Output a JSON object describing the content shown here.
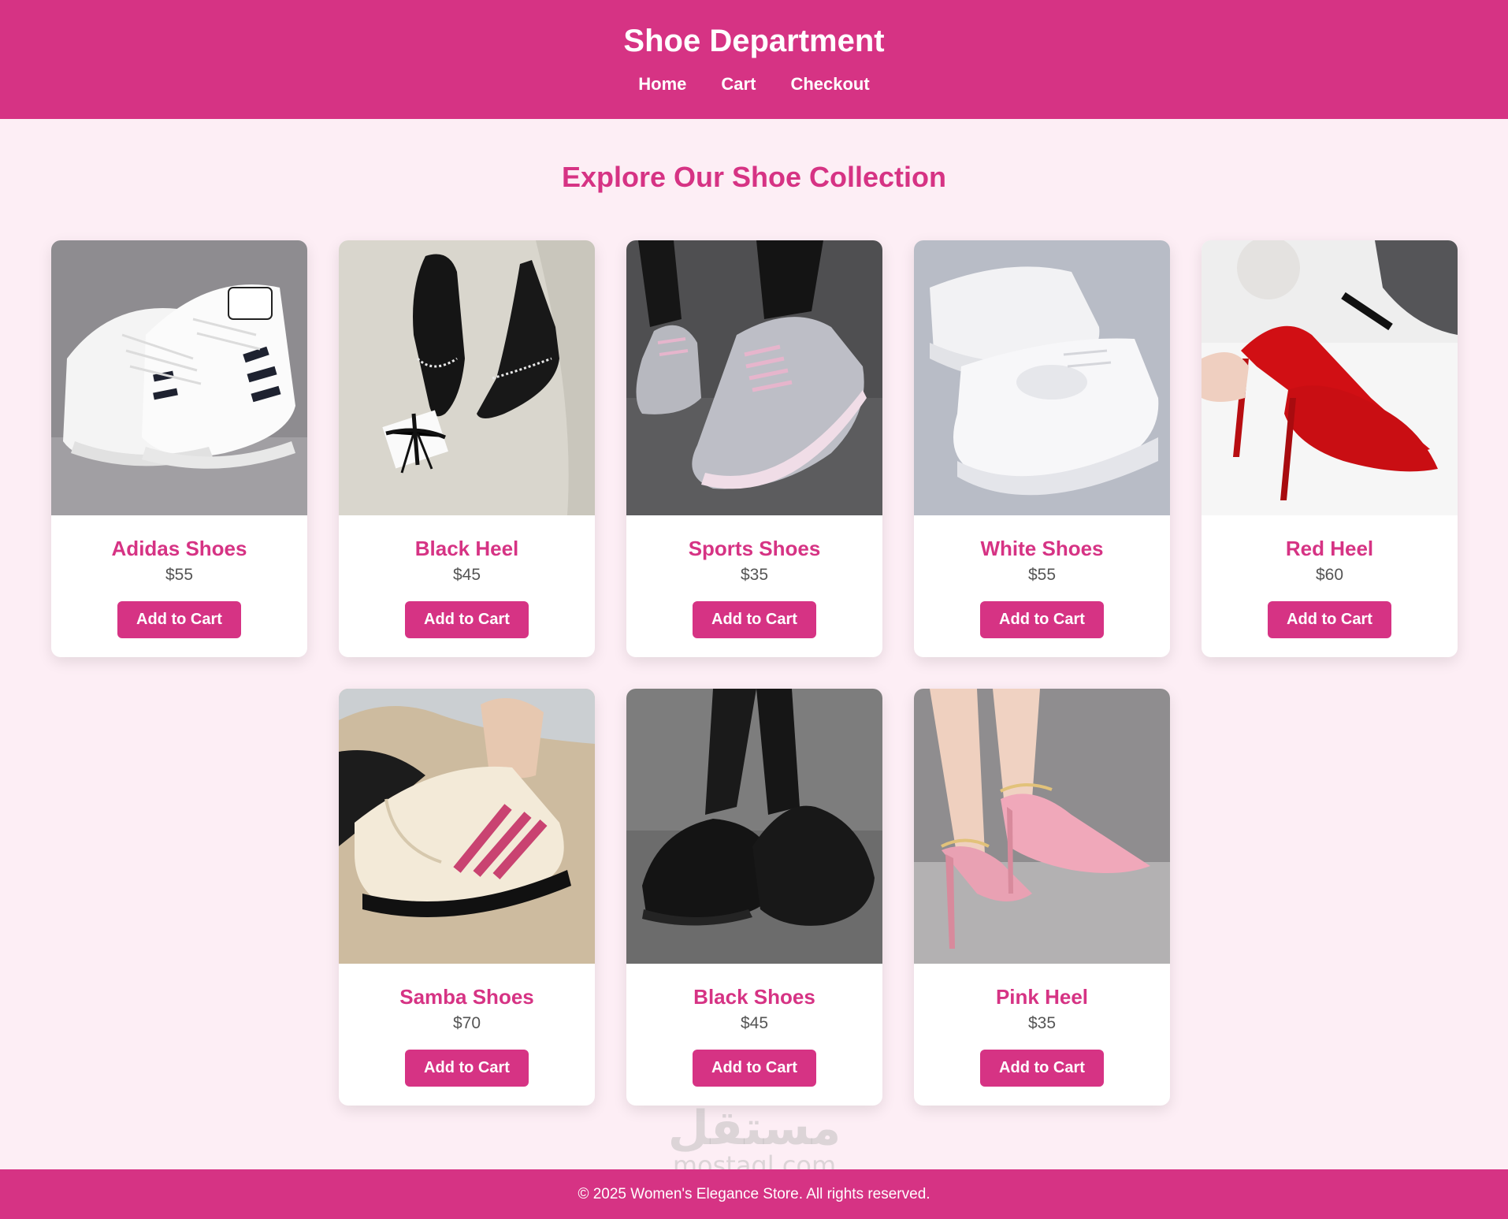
{
  "header": {
    "title": "Shoe Department",
    "nav": [
      "Home",
      "Cart",
      "Checkout"
    ]
  },
  "main": {
    "title": "Explore Our Shoe Collection",
    "add_to_cart_label": "Add to Cart",
    "products": [
      {
        "name": "Adidas Shoes",
        "price": "$55",
        "image": "white-black-striped-sneakers"
      },
      {
        "name": "Black Heel",
        "price": "$45",
        "image": "black-slingback-heels"
      },
      {
        "name": "Sports Shoes",
        "price": "$35",
        "image": "grey-pink-running-shoes"
      },
      {
        "name": "White Shoes",
        "price": "$55",
        "image": "white-platform-sneakers"
      },
      {
        "name": "Red Heel",
        "price": "$60",
        "image": "red-suede-pumps"
      },
      {
        "name": "Samba Shoes",
        "price": "$70",
        "image": "cream-pink-striped-sneakers"
      },
      {
        "name": "Black Shoes",
        "price": "$45",
        "image": "black-chunky-sneakers"
      },
      {
        "name": "Pink Heel",
        "price": "$35",
        "image": "pink-ankle-strap-heels"
      }
    ]
  },
  "watermark": {
    "logo": "مستقل",
    "domain": "mostaql.com"
  },
  "footer": {
    "text": "© 2025 Women's Elegance Store. All rights reserved."
  },
  "colors": {
    "brand": "#d63384",
    "background": "#fdeef5",
    "card": "#ffffff",
    "price": "#555555"
  }
}
